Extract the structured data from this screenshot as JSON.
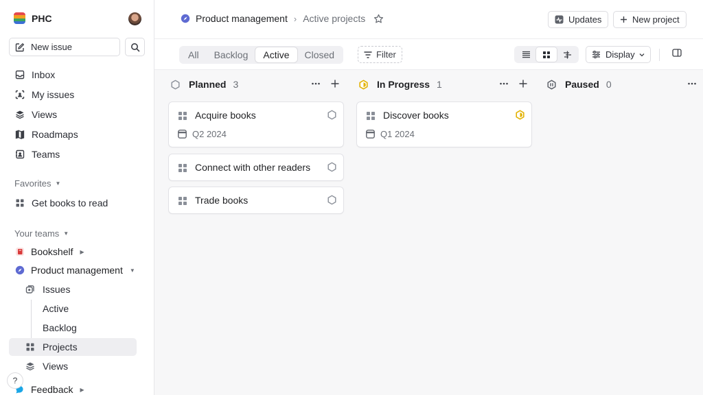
{
  "workspace": {
    "name": "PHC",
    "logo_colors": [
      "#e5484d",
      "#f0a020",
      "#3aa55d",
      "#3b6fd6"
    ]
  },
  "sidebar": {
    "new_issue_label": "New issue",
    "nav": [
      {
        "label": "Inbox",
        "icon": "inbox-icon"
      },
      {
        "label": "My issues",
        "icon": "my-issues-icon"
      },
      {
        "label": "Views",
        "icon": "views-icon"
      },
      {
        "label": "Roadmaps",
        "icon": "roadmap-icon"
      },
      {
        "label": "Teams",
        "icon": "teams-icon"
      }
    ],
    "favorites_label": "Favorites",
    "favorites": [
      {
        "label": "Get books to read",
        "icon": "project-icon"
      }
    ],
    "your_teams_label": "Your teams",
    "teams": [
      {
        "label": "Bookshelf",
        "icon": "book-icon",
        "color": "#d93a3a"
      },
      {
        "label": "Product management",
        "icon": "compass-icon",
        "color": "#5e6ad2"
      }
    ],
    "team_sub": [
      {
        "label": "Issues",
        "icon": "issues-icon"
      },
      {
        "label": "Active"
      },
      {
        "label": "Backlog"
      },
      {
        "label": "Projects",
        "icon": "project-icon",
        "selected": true
      },
      {
        "label": "Views",
        "icon": "views-icon"
      }
    ],
    "feedback_label": "Feedback",
    "help_label": "?"
  },
  "header": {
    "breadcrumb_project": "Product management",
    "breadcrumb_separator": "›",
    "breadcrumb_current": "Active projects",
    "updates_label": "Updates",
    "new_project_label": "New project"
  },
  "viewbar": {
    "tabs": [
      "All",
      "Backlog",
      "Active",
      "Closed"
    ],
    "active_tab": "Active",
    "filter_label": "Filter",
    "display_label": "Display"
  },
  "colors": {
    "accent": "#5e6ad2",
    "in_progress": "#e2b203",
    "muted": "#8a8f98"
  },
  "board": {
    "columns": [
      {
        "title": "Planned",
        "count": "3",
        "status_icon": "planned-hexagon-icon",
        "cards": [
          {
            "title": "Acquire books",
            "date": "Q2 2024"
          },
          {
            "title": "Connect with other readers"
          },
          {
            "title": "Trade books"
          }
        ]
      },
      {
        "title": "In Progress",
        "count": "1",
        "status_icon": "in-progress-hexagon-icon",
        "cards": [
          {
            "title": "Discover books",
            "date": "Q1 2024"
          }
        ]
      },
      {
        "title": "Paused",
        "count": "0",
        "status_icon": "paused-hexagon-icon",
        "cards": []
      }
    ]
  }
}
